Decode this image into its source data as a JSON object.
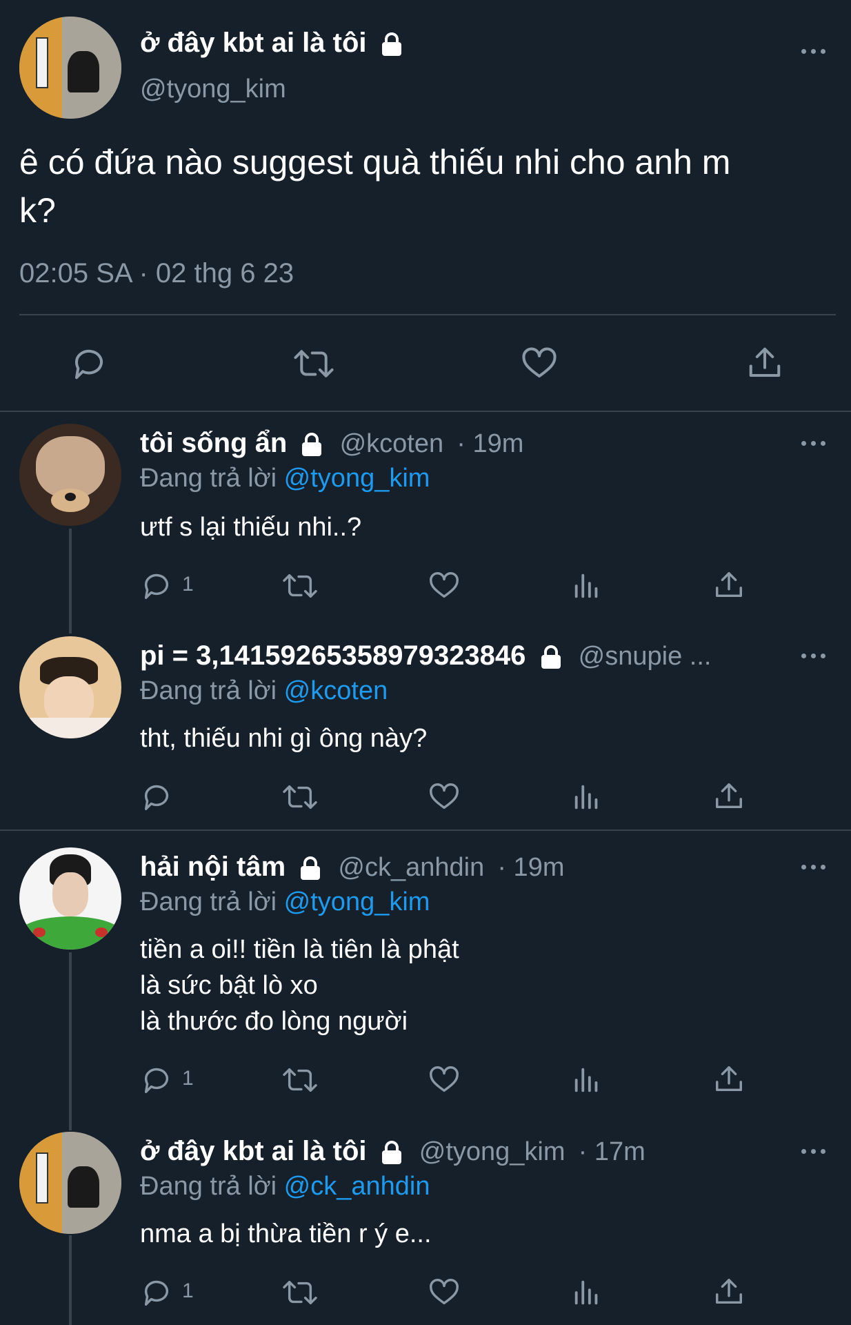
{
  "main_tweet": {
    "display_name": "ở đây kbt ai là tôi",
    "handle": "@tyong_kim",
    "text_line1": "ê có đứa nào suggest quà thiếu nhi cho anh m",
    "text_line2": "k?",
    "timestamp": "02:05 SA · 02 thg 6 23"
  },
  "replying_to_label": "Đang trả lời",
  "replies": [
    {
      "display_name": "tôi sống ẩn",
      "handle": "@kcoten",
      "time": "· 19m",
      "replying_to": "@tyong_kim",
      "lines": [
        "ưtf s lại thiếu nhi..?"
      ],
      "reply_count": "1"
    },
    {
      "display_name": "pi = 3,14159265358979323846",
      "handle": "@snupie ...",
      "time": "",
      "replying_to": "@kcoten",
      "lines": [
        "tht, thiếu nhi gì ông này?"
      ],
      "reply_count": ""
    },
    {
      "display_name": "hải nội tâm",
      "handle": "@ck_anhdin",
      "time": "· 19m",
      "replying_to": "@tyong_kim",
      "lines": [
        "tiền a oi!! tiền là tiên là phật",
        "là sức bật lò xo",
        "là thước đo lòng người"
      ],
      "reply_count": "1"
    },
    {
      "display_name": "ở đây kbt ai là tôi",
      "handle": "@tyong_kim",
      "time": "· 17m",
      "replying_to": "@ck_anhdin",
      "lines": [
        "nma a bị thừa tiền r ý e..."
      ],
      "reply_count": "1"
    }
  ],
  "colors": {
    "background": "#15202b",
    "muted": "#8b98a5",
    "link": "#1d9bf0",
    "divider": "#38444d"
  },
  "icons": [
    "lock-icon",
    "more-icon",
    "reply-icon",
    "retweet-icon",
    "like-icon",
    "share-icon",
    "analytics-icon"
  ]
}
